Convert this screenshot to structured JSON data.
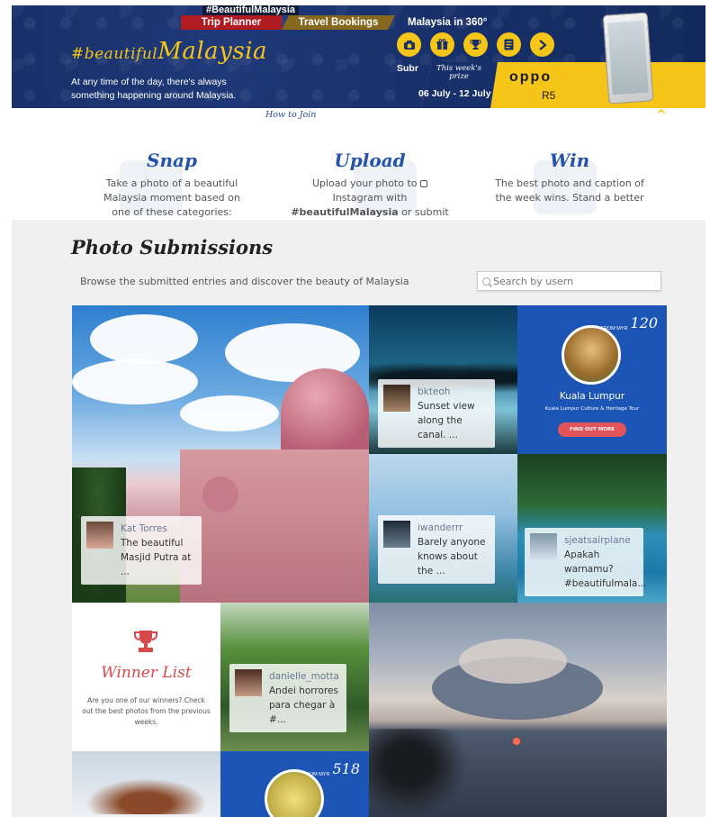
{
  "banner": {
    "hashtag": "#BeautifulMalaysia",
    "nav": [
      "Trip Planner",
      "Travel Bookings",
      "Malaysia in 360°"
    ],
    "title_prefix": "#beautiful",
    "title_main": "Malaysia",
    "subtitle": "At any time of the day, there's always something happening around Malaysia.",
    "icons": [
      "camera-icon",
      "gift-icon",
      "trophy-icon",
      "document-icon",
      "arrow-right-icon"
    ],
    "submit_label": "Subr",
    "prize_label": "This week's prize",
    "prize_dates": "06 July - 12 July",
    "prize_brand": "oppo",
    "prize_model": "R5",
    "how_to_join": "How to Join",
    "colors": {
      "brand_blue": "#17306a",
      "brand_yellow": "#f5c518",
      "accent_red": "#b11c22"
    }
  },
  "steps": [
    {
      "title": "Snap",
      "text": "Take a photo of a beautiful Malaysia moment based on one of these categories:"
    },
    {
      "title": "Upload",
      "text_pre": "Upload your photo to ",
      "text_mid": "Instagram with ",
      "hashtag": "#beautifulMalaysia",
      "text_post": " or submit"
    },
    {
      "title": "Win",
      "text": "The best photo and caption of the week wins. Stand a better"
    }
  ],
  "submissions": {
    "title": "Photo Submissions",
    "description": "Browse the submitted entries and discover the beauty of Malaysia",
    "search_placeholder": "Search by usern"
  },
  "tiles": {
    "kat": {
      "user": "Kat Torres",
      "caption": "The beautiful Masjid Putra at ..."
    },
    "bkteoh": {
      "user": "bkteoh",
      "caption": "Sunset view along the canal. ..."
    },
    "iwanderrr": {
      "user": "iwanderrr",
      "caption": "Barely anyone knows about the ..."
    },
    "sjeats": {
      "user": "sjeatsairplane",
      "caption": "Apakah warnamu? #beautifulmala..."
    },
    "danielle": {
      "user": "danielle_motta",
      "caption": "Andei horrores para chegar à #..."
    },
    "kl": {
      "from_label": "FROM MYR",
      "price": "120",
      "city": "Kuala Lumpur",
      "tour": "Kuala Lumpur Culture & Heritage Tour",
      "cta": "FIND OUT MORE"
    },
    "winner": {
      "title": "Winner List",
      "text": "Are you one of our winners? Check out the best photos from the previous weeks."
    },
    "durian": {
      "from_label": "FROM MYR",
      "price": "518"
    }
  }
}
